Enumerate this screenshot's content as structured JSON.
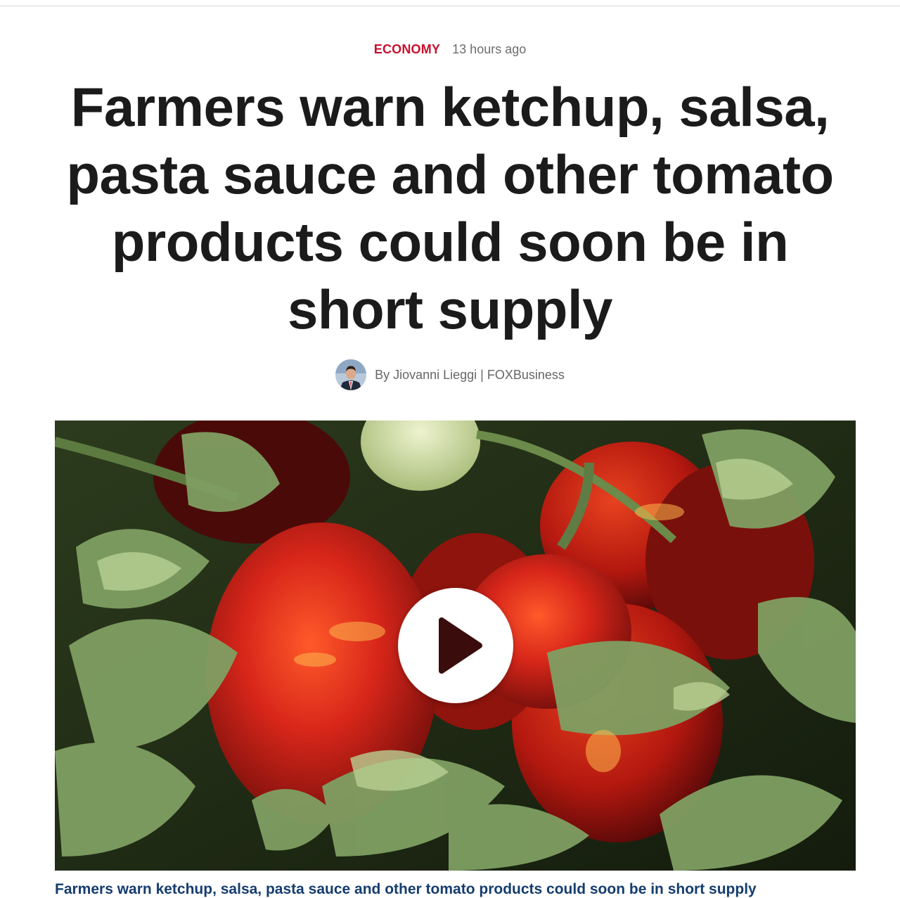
{
  "article": {
    "category": "ECONOMY",
    "timestamp": "13 hours ago",
    "headline": "Farmers warn ketchup, salsa, pasta sauce and other tomato products could soon be in short supply",
    "byline": "By Jiovanni Lieggi | FOXBusiness"
  },
  "video": {
    "caption": "Farmers warn ketchup, salsa, pasta sauce and other tomato products could soon be in short supply",
    "play_icon": "play-icon"
  },
  "colors": {
    "category": "#c8102e",
    "headline": "#1b1b1b",
    "caption": "#153d6e"
  }
}
